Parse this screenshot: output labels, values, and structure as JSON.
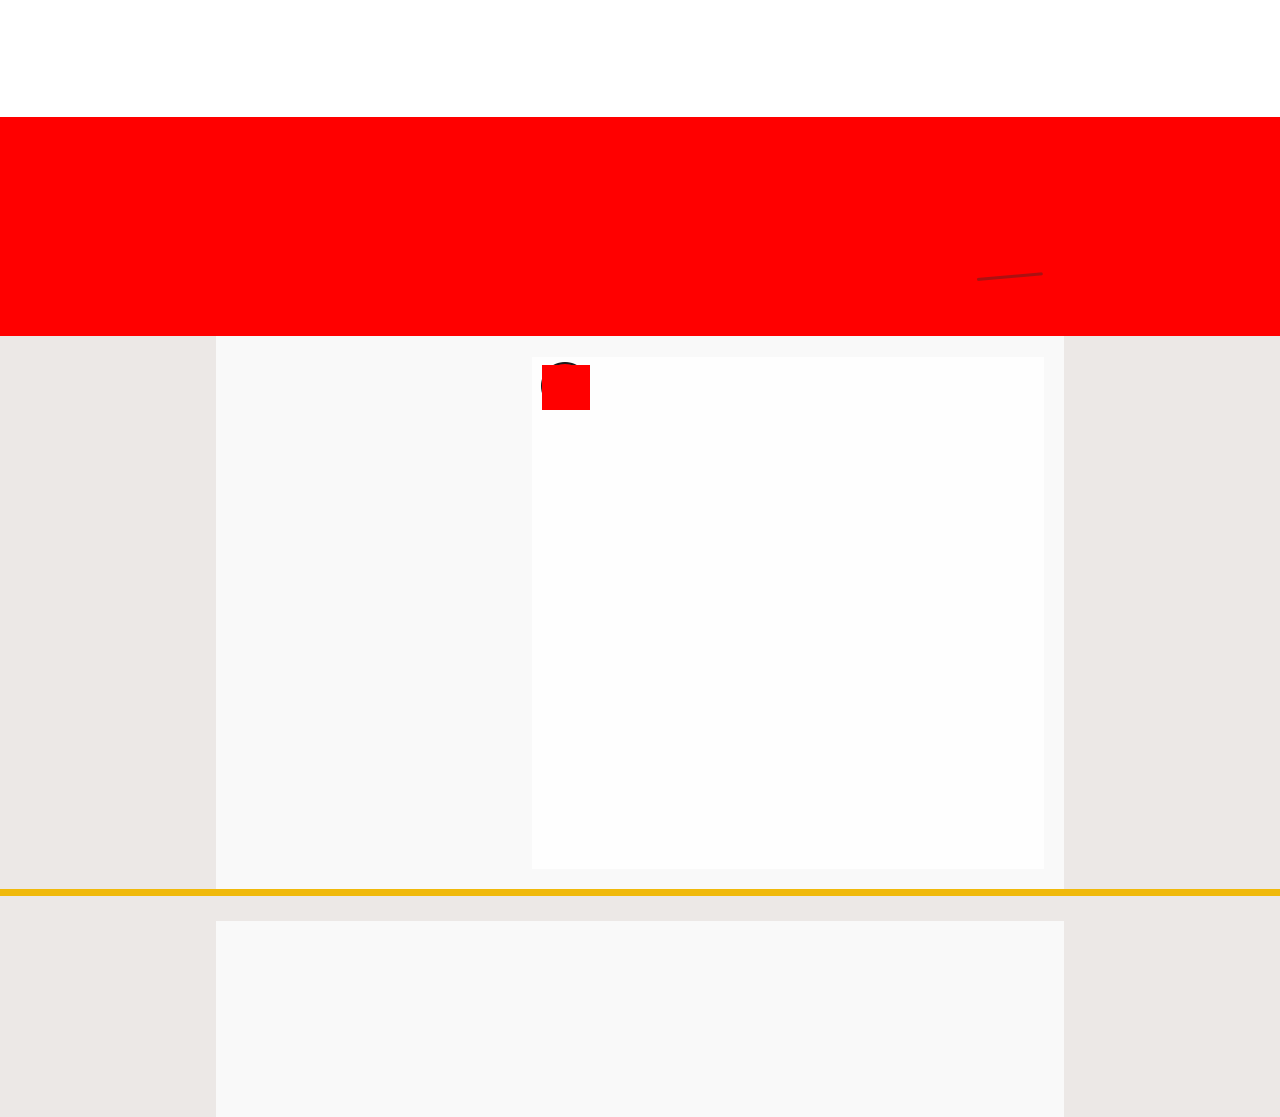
{
  "colors": {
    "header_bg": "#ffffff",
    "hero_bg": "#ff0000",
    "hero_stroke": "#9b1414",
    "page_bg": "#ece8e6",
    "panel_bg": "#f9f9f9",
    "card_bg": "#fefefe",
    "badge_fill": "#ff0000",
    "badge_outline": "#1a1a1a",
    "divider": "#f0b90b"
  },
  "icons": {
    "card_badge": "red-square-badge-icon"
  }
}
